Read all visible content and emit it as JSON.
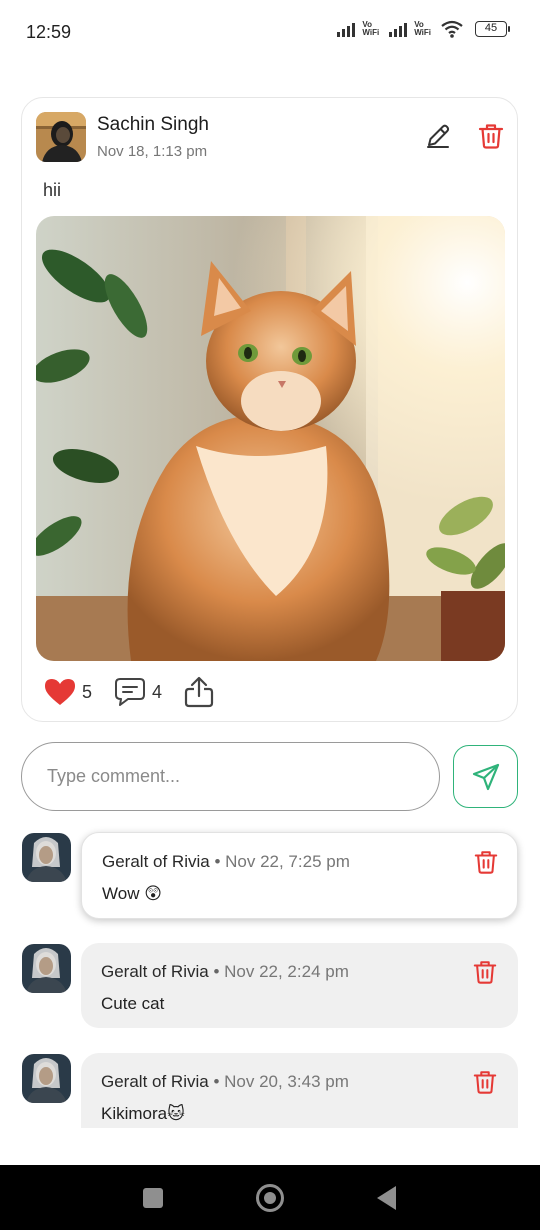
{
  "status_bar": {
    "time": "12:59",
    "battery": "45",
    "vo_label": "Vo",
    "wifi_label": "WiFi"
  },
  "post": {
    "author": "Sachin Singh",
    "time": "Nov 18, 1:13 pm",
    "text": "hii",
    "likes": "5",
    "comments": "4"
  },
  "comment_input": {
    "placeholder": "Type comment..."
  },
  "comments": [
    {
      "author": "Geralt of Rivia",
      "separator": "•",
      "time": "Nov 22, 7:25 pm",
      "text": "Wow 😲"
    },
    {
      "author": "Geralt of Rivia",
      "separator": "•",
      "time": "Nov 22, 2:24 pm",
      "text": "Cute cat"
    },
    {
      "author": "Geralt of Rivia",
      "separator": "•",
      "time": "Nov 20, 3:43 pm",
      "text": "Kikimora🐱"
    }
  ],
  "colors": {
    "accent_green": "#2fb37a",
    "delete_red": "#e53935",
    "like_red": "#e53935"
  },
  "icons": {
    "edit": "pencil-icon",
    "delete": "trash-icon",
    "like": "heart-icon",
    "comment": "comment-icon",
    "share": "share-icon",
    "send": "send-icon"
  }
}
